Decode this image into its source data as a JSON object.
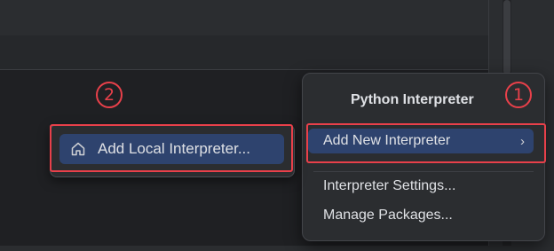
{
  "popup_menu": {
    "title": "Python Interpreter",
    "items": [
      {
        "label": "Add New Interpreter",
        "selected": true,
        "has_submenu": true,
        "submenu_icon": "chevron-right-icon"
      },
      {
        "label": "Interpreter Settings...",
        "selected": false
      },
      {
        "label": "Manage Packages...",
        "selected": false
      }
    ]
  },
  "submenu": {
    "add_local_label": "Add Local Interpreter...",
    "icon": "home-icon"
  },
  "annotations": {
    "step1": "1",
    "step2": "2",
    "color": "#e8404a"
  },
  "colors": {
    "selection": "#2e436e",
    "popup_bg": "#2b2d30",
    "text": "#dfe1e5"
  }
}
